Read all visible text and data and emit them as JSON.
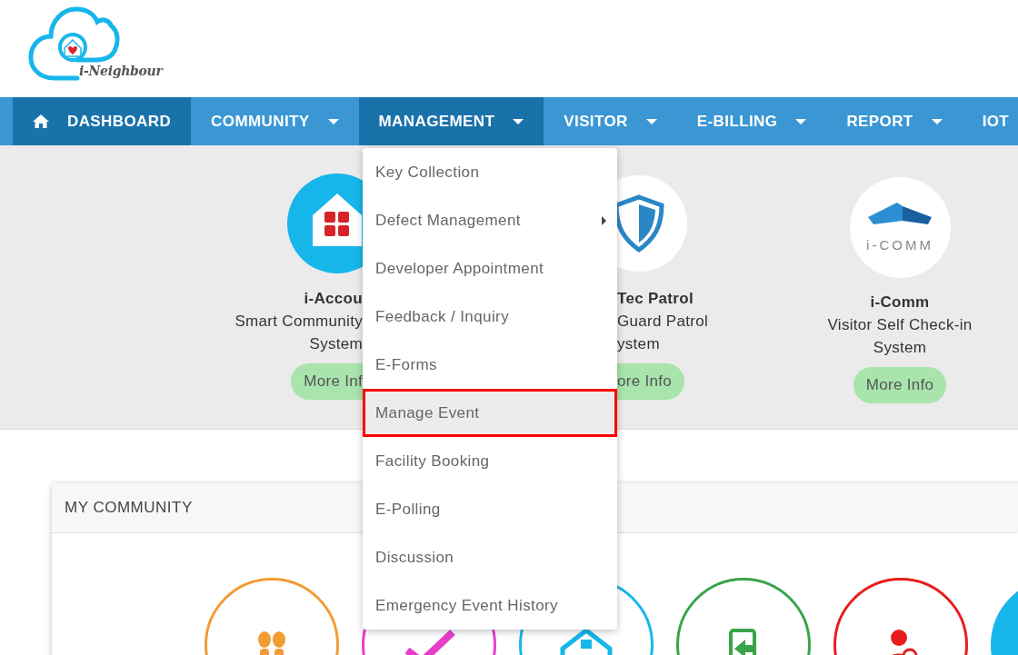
{
  "logo": {
    "text": "i-Neighbour"
  },
  "nav": [
    {
      "label": "DASHBOARD",
      "kind": "home",
      "dropdown": false,
      "selected": true,
      "expanded": false
    },
    {
      "label": "COMMUNITY",
      "dropdown": true,
      "selected": false,
      "expanded": false
    },
    {
      "label": "MANAGEMENT",
      "dropdown": true,
      "selected": false,
      "expanded": true
    },
    {
      "label": "VISITOR",
      "dropdown": true,
      "selected": false,
      "expanded": false
    },
    {
      "label": "E-BILLING",
      "dropdown": true,
      "selected": false,
      "expanded": false
    },
    {
      "label": "REPORT",
      "dropdown": true,
      "selected": false,
      "expanded": false
    },
    {
      "label": "IOT",
      "dropdown": false,
      "selected": false,
      "expanded": false
    }
  ],
  "apps": [
    {
      "kind": "calculator-house",
      "title": "i-Accou",
      "description": [
        "Smart Community",
        "System"
      ],
      "button": "More Inf"
    },
    {
      "kind": "shield",
      "title": "Tec Patrol",
      "description": [
        "Guard Patrol",
        "ystem"
      ],
      "button": "ore Info"
    },
    {
      "kind": "comm-logo",
      "logo_text": "i-COMM",
      "title": "i-Comm",
      "description": [
        "Visitor Self Check-in",
        "System"
      ],
      "button": "More Info"
    }
  ],
  "dropdown_menu": [
    {
      "label": "Key Collection",
      "submenu": false,
      "selected": false
    },
    {
      "label": "Defect Management",
      "submenu": true,
      "selected": false
    },
    {
      "label": "Developer Appointment",
      "submenu": false,
      "selected": false
    },
    {
      "label": "Feedback / Inquiry",
      "submenu": false,
      "selected": false
    },
    {
      "label": "E-Forms",
      "submenu": false,
      "selected": false
    },
    {
      "label": "Manage Event",
      "submenu": false,
      "selected": true
    },
    {
      "label": "Facility Booking",
      "submenu": false,
      "selected": false
    },
    {
      "label": "E-Polling",
      "submenu": false,
      "selected": false
    },
    {
      "label": "Discussion",
      "submenu": false,
      "selected": false
    },
    {
      "label": "Emergency Event History",
      "submenu": false,
      "selected": false
    }
  ],
  "community": {
    "title": "MY COMMUNITY",
    "tiles": [
      {
        "kind": "footprints",
        "color": "#f39c34",
        "filled": false
      },
      {
        "kind": "check",
        "color": "#e83ecb",
        "filled": false
      },
      {
        "kind": "building",
        "color": "#17b6ea",
        "filled": false
      },
      {
        "kind": "door",
        "color": "#3aa44a",
        "filled": false
      },
      {
        "kind": "person",
        "color": "#e81c1c",
        "filled": false
      },
      {
        "kind": "blank",
        "color": "#17b6ea",
        "filled": true
      }
    ]
  }
}
